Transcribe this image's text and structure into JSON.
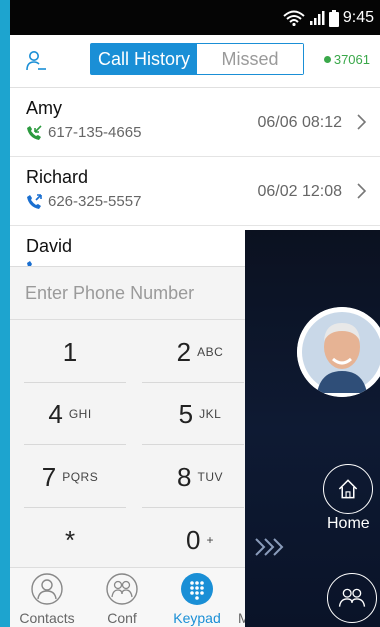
{
  "status_bar": {
    "time": "9:45"
  },
  "header": {
    "tabs": [
      {
        "label": "Call History",
        "active": true
      },
      {
        "label": "Missed",
        "active": false
      }
    ],
    "online_count": "37061",
    "accent_color": "#1a8fd6",
    "online_color": "#3aa84a"
  },
  "calls": [
    {
      "name": "Amy",
      "number": "617-135-4665",
      "date": "06/06",
      "time": "08:12",
      "type": "incoming"
    },
    {
      "name": "Richard",
      "number": "626-325-5557",
      "date": "06/02",
      "time": "12:08",
      "type": "outgoing"
    },
    {
      "name": "David",
      "type": "outgoing"
    }
  ],
  "keypad": {
    "placeholder": "Enter Phone Number",
    "keys": [
      {
        "digit": "1",
        "letters": ""
      },
      {
        "digit": "2",
        "letters": "ABC"
      },
      {
        "digit": "4",
        "letters": "GHI"
      },
      {
        "digit": "5",
        "letters": "JKL"
      },
      {
        "digit": "7",
        "letters": "PQRS"
      },
      {
        "digit": "8",
        "letters": "TUV"
      },
      {
        "digit": "*",
        "letters": ""
      },
      {
        "digit": "0",
        "letters": "+"
      }
    ]
  },
  "tabbar": {
    "items": [
      {
        "label": "Contacts",
        "icon": "contacts-icon",
        "active": false
      },
      {
        "label": "Conf",
        "icon": "conference-icon",
        "active": false
      },
      {
        "label": "Keypad",
        "icon": "keypad-icon",
        "active": true
      }
    ],
    "partial_label": "M"
  },
  "overlay": {
    "home_label": "Home",
    "icons": [
      "avatar-photo",
      "home-icon",
      "groups-icon",
      "double-chevron-right-icon"
    ]
  }
}
